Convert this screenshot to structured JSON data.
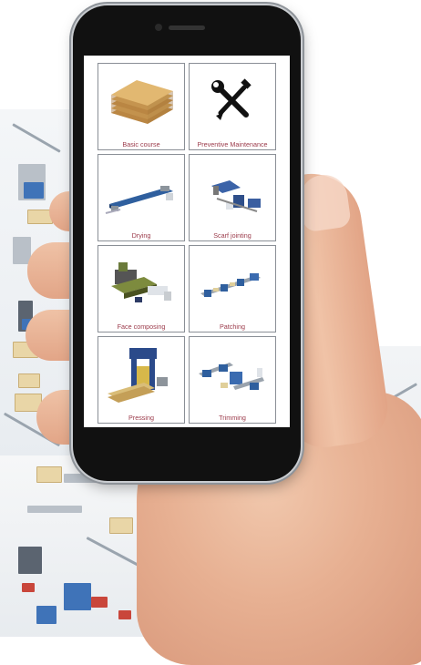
{
  "courses": [
    {
      "label": "Basic course",
      "icon": "plywood-stack-icon"
    },
    {
      "label": "Preventive Maintenance",
      "icon": "wrench-screwdriver-icon"
    },
    {
      "label": "Drying",
      "icon": "drying-line-icon"
    },
    {
      "label": "Scarf jointing",
      "icon": "scarf-jointing-machine-icon"
    },
    {
      "label": "Face composing",
      "icon": "face-composing-machine-icon"
    },
    {
      "label": "Patching",
      "icon": "patching-line-icon"
    },
    {
      "label": "Pressing",
      "icon": "press-machine-icon"
    },
    {
      "label": "Trimming",
      "icon": "trimming-line-icon"
    }
  ],
  "colors": {
    "label_text": "#9b3a4a",
    "tile_border": "#8a8f96",
    "phone_body": "#111111"
  }
}
